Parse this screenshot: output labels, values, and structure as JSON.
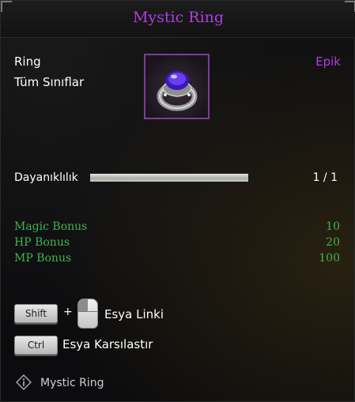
{
  "tooltip": {
    "title": "Mystic Ring",
    "item_type": "Ring",
    "item_class": "Tüm Sınıflar",
    "rarity": "Epik",
    "icon": "ring-icon",
    "durability": {
      "label": "Dayanıklılık",
      "value_text": "1 / 1",
      "fraction": 1.0
    },
    "bonuses": [
      {
        "name": "Magic Bonus",
        "value": "10"
      },
      {
        "name": "HP Bonus",
        "value": "20"
      },
      {
        "name": "MP Bonus",
        "value": "100"
      }
    ],
    "hints": {
      "shift_key": "Shift",
      "plus": "+",
      "link_action": "Esya Linki",
      "ctrl_key": "Ctrl",
      "compare_action": "Esya Karsılastır"
    },
    "footer": {
      "icon": "info-icon",
      "text": "Mystic Ring"
    }
  },
  "colors": {
    "title": "#b23de0",
    "rarity": "#b23de0",
    "bonus": "#3fb54a"
  }
}
